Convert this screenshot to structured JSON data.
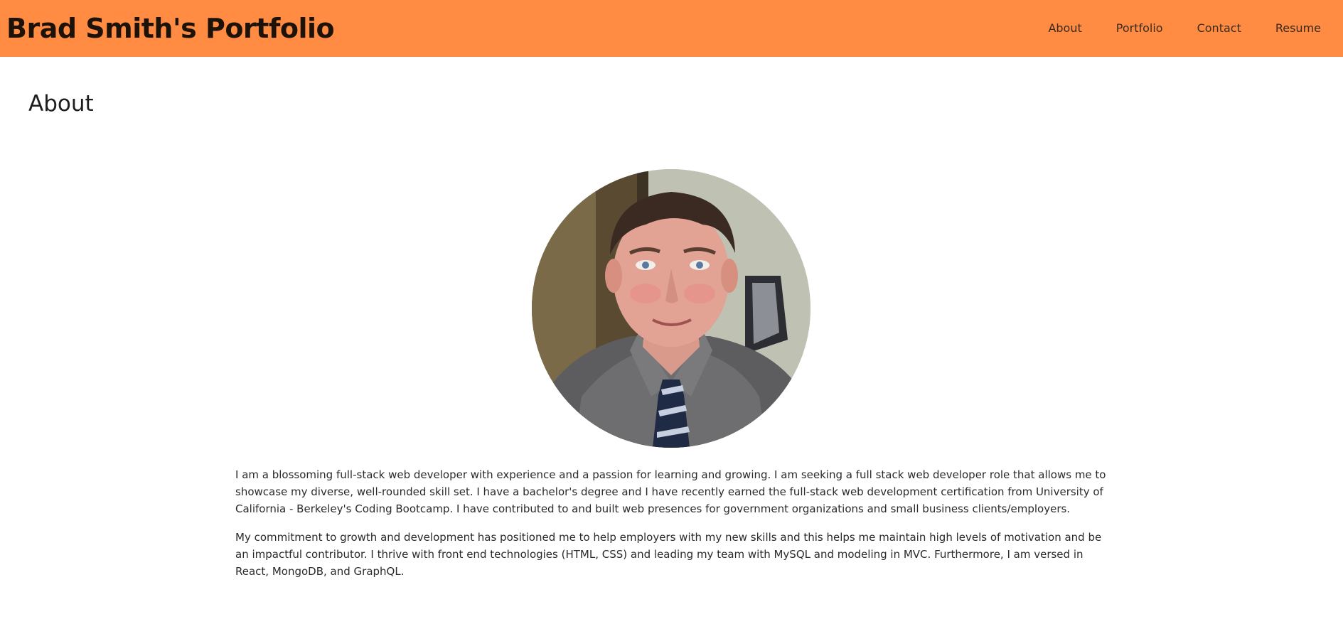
{
  "header": {
    "brand": "Brad Smith's Portfolio",
    "nav": [
      {
        "label": "About"
      },
      {
        "label": "Portfolio"
      },
      {
        "label": "Contact"
      },
      {
        "label": "Resume"
      }
    ],
    "background": "#ff8c42"
  },
  "about": {
    "title": "About",
    "photo_subject": "portrait-photo",
    "paragraphs": [
      "I am a blossoming full-stack web developer with experience and a passion for learning and growing. I am seeking a full stack web developer role that allows me to showcase my diverse, well-rounded skill set. I have a bachelor's degree and I have recently earned the full-stack web development certification from University of California - Berkeley's Coding Bootcamp. I have contributed to and built web presences for government organizations and small business clients/employers.",
      "My commitment to growth and development has positioned me to help employers with my new skills and this helps me maintain high levels of motivation and be an impactful contributor. I thrive with front end technologies (HTML, CSS) and leading my team with MySQL and modeling in MVC. Furthermore, I am versed in React, MongoDB, and GraphQL."
    ]
  }
}
